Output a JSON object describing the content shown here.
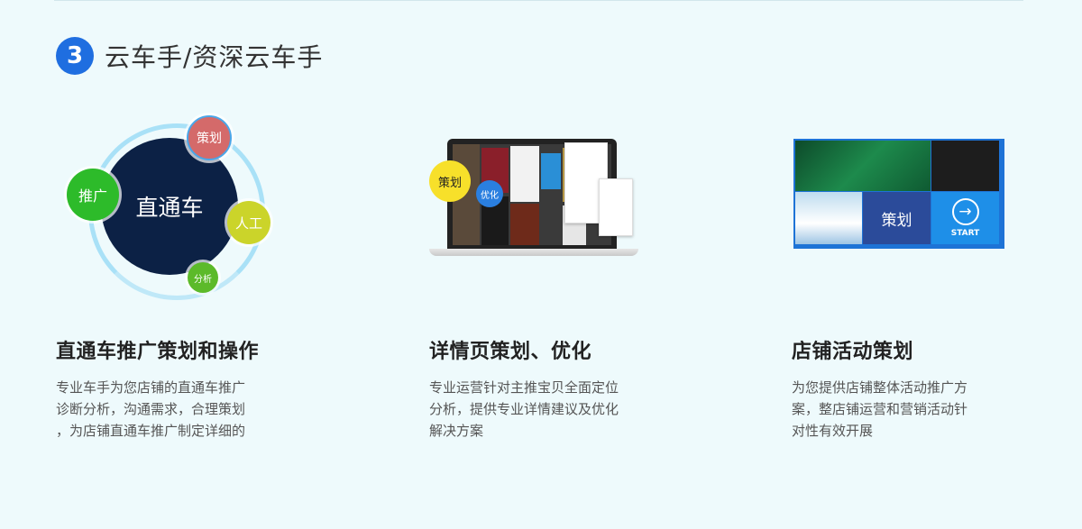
{
  "section": {
    "number": "3",
    "title": "云车手/资深云车手"
  },
  "illustration1": {
    "center_label": "直通车",
    "bubbles": {
      "promote": "推广",
      "plan": "策划",
      "manual": "人工",
      "analysis": "分析"
    }
  },
  "illustration2": {
    "bubble_plan": "策划",
    "bubble_optimize": "优化"
  },
  "illustration3": {
    "plan_label": "策划",
    "start_label": "START",
    "start_icon": "arrow-right-circle-icon"
  },
  "columns": [
    {
      "title": "直通车推广策划和操作",
      "desc_lines": [
        "专业车手为您店铺的直通车推广",
        "诊断分析，沟通需求，合理策划",
        "，为店铺直通车推广制定详细的"
      ]
    },
    {
      "title": "详情页策划、优化",
      "desc_lines": [
        "专业运营针对主推宝贝全面定位",
        "分析，提供专业详情建议及优化",
        "解决方案"
      ]
    },
    {
      "title": "店铺活动策划",
      "desc_lines": [
        "为您提供店铺整体活动推广方",
        "案，整店铺运营和营销活动针",
        "对性有效开展"
      ]
    }
  ],
  "colors": {
    "background": "#eefafc",
    "accent_blue": "#1f6ee0",
    "navy": "#0c2145"
  }
}
